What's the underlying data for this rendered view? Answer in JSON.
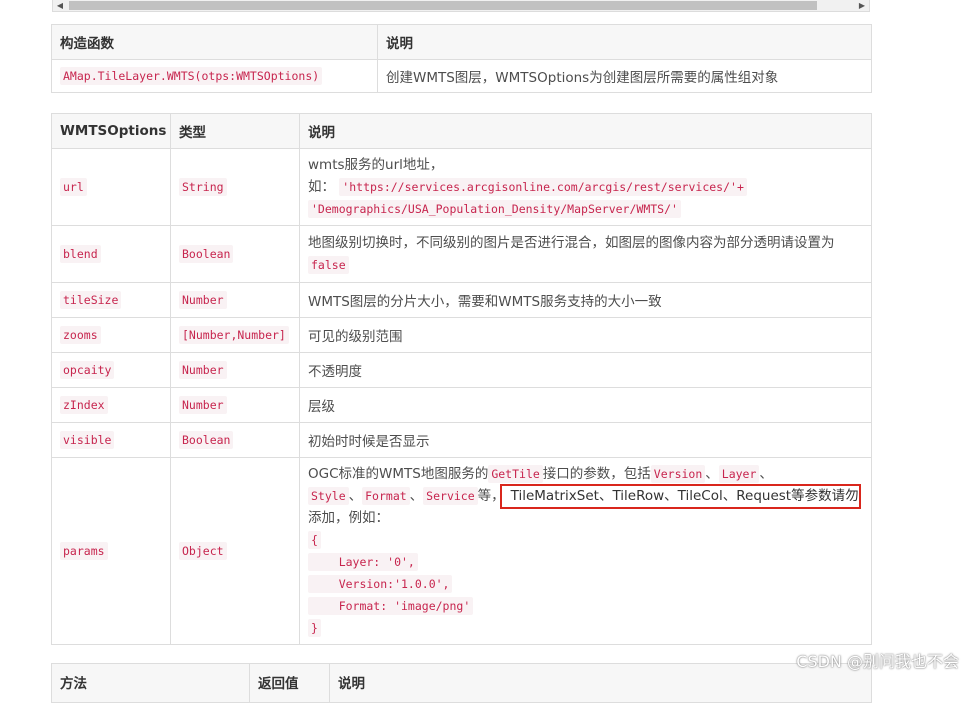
{
  "scrollbar": {
    "left_arrow": "◀",
    "right_arrow": "▶"
  },
  "constructor_table": {
    "headers": [
      "构造函数",
      "说明"
    ],
    "row": {
      "code": "AMap.TileLayer.WMTS(otps:WMTSOptions)",
      "desc": "创建WMTS图层，WMTSOptions为创建图层所需要的属性组对象"
    }
  },
  "options_table": {
    "headers": [
      "WMTSOptions",
      "类型",
      "说明"
    ],
    "url": {
      "name": "url",
      "type": "String",
      "desc_line1": "wmts服务的url地址，",
      "desc_prefix": "如：",
      "code1": "'https://services.arcgisonline.com/arcgis/rest/services/'+",
      "code2": "'Demographics/USA_Population_Density/MapServer/WMTS/'"
    },
    "blend": {
      "name": "blend",
      "type": "Boolean",
      "desc": "地图级别切换时，不同级别的图片是否进行混合，如图层的图像内容为部分透明请设置为",
      "code": "false"
    },
    "rows": [
      {
        "name": "tileSize",
        "type": "Number",
        "desc": "WMTS图层的分片大小，需要和WMTS服务支持的大小一致"
      },
      {
        "name": "zooms",
        "type": "[Number,Number]",
        "desc": "可见的级别范围"
      },
      {
        "name": "opcaity",
        "type": "Number",
        "desc": "不透明度"
      },
      {
        "name": "zIndex",
        "type": "Number",
        "desc": "层级"
      },
      {
        "name": "visible",
        "type": "Boolean",
        "desc": "初始时时候是否显示"
      }
    ],
    "params": {
      "name": "params",
      "type": "Object",
      "t1": "OGC标准的WMTS地图服务的",
      "c_gettile": "GetTile",
      "t2": "接口的参数，包括",
      "c_version": "Version",
      "sep1": "、",
      "c_layer": "Layer",
      "sep2": "、",
      "c_style": "Style",
      "sep3": "、",
      "c_format": "Format",
      "sep4": "、",
      "c_service": "Service",
      "t3": "等，",
      "highlight": "TileMatrixSet、TileRow、TileCol、Request等参数请勿",
      "t4": "添加，例如：",
      "code_lines": [
        "{",
        "    Layer: '0',",
        "    Version:'1.0.0',",
        "    Format: 'image/png'",
        "}"
      ]
    }
  },
  "methods_table": {
    "headers": [
      "方法",
      "返回值",
      "说明"
    ]
  },
  "watermark": "CSDN @别问我也不会"
}
